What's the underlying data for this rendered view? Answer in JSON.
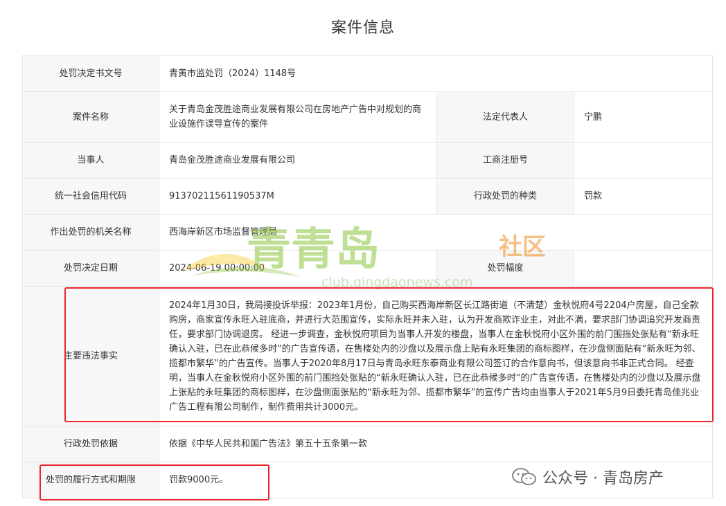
{
  "page": {
    "title": "案件信息"
  },
  "rows": {
    "doc_no": {
      "label": "处罚决定书文号",
      "value": "青黄市监处罚（2024）1148号"
    },
    "case_name": {
      "label": "案件名称",
      "value": "关于青岛金茂胜途商业发展有限公司在房地产广告中对规划的商业设施作误导宣传的案件"
    },
    "legal_rep": {
      "label": "法定代表人",
      "value": "宁鹏"
    },
    "party": {
      "label": "当事人",
      "value": "青岛金茂胜途商业发展有限公司"
    },
    "biz_reg": {
      "label": "工商注册号",
      "value": ""
    },
    "credit_code": {
      "label": "统一社会信用代码",
      "value": "91370211561190537M"
    },
    "penalty_type": {
      "label": "行政处罚的种类",
      "value": "罚款"
    },
    "authority": {
      "label": "作出处罚的机关名称",
      "value": "西海岸新区市场监督管理局"
    },
    "date": {
      "label": "处罚决定日期",
      "value": "2024-06-19 00:00:00"
    },
    "range": {
      "label": "处罚幅度",
      "value": ""
    },
    "facts": {
      "label": "主要违法事实",
      "value": "2024年1月30日，我局接投诉举报：2023年1月份，自己购买西海岸新区长江路街道（不清楚）金秋悦府4号2204户房屋，自己全款购房，商家宣传永旺入驻底商，并进行大范围宣传，实际永旺并未入驻，认为开发商欺诈业主，对此不满，要求部门协调追究开发商责任，要求部门协调退房。 经进一步调查，金秋悦府项目为当事人开发的楼盘，当事人在金秋悦府小区外围的前门围挡处张贴有“新永旺确认入驻，已在此恭候多时”的广告宣传语，在售楼处内的沙盘以及展示盘上贴有永旺集团的商标图样，在沙盘侧面贴有“新永旺为邻、揽都市繁华”的广告宣传。当事人于2020年8月17日与青岛永旺东泰商业有限公司签订的合作意向书，但该意向书非正式合同。 经查明，当事人在金秋悦府小区外围的前门围挡处张贴的“新永旺确认入驻，已在此恭候多时”的广告宣传语，在售楼处内的沙盘以及展示盘上张贴的永旺集团的商标图样，在沙盘侧面张贴的“新永旺为邻、揽都市繁华”的宣传广告均由当事人于2021年5月9日委托青岛佳兆业广告工程有限公司制作，制作费用共计3000元。"
    },
    "basis": {
      "label": "行政处罚依据",
      "value": "依据《中华人民共和国广告法》第五十五条第一款"
    },
    "execution": {
      "label": "处罚的履行方式和期限",
      "value": "罚款9000元。"
    }
  },
  "watermark": {
    "main_text": "青青岛",
    "sub_text": "社区",
    "url": "club.qingdaonews.com",
    "footer": "公众号 · 青岛房产",
    "icon": "wechat-icon",
    "colors": {
      "green": "#8cc63f",
      "orange": "#f08c1e",
      "yellow": "#f5c518"
    }
  },
  "highlight_color": "#e8262b"
}
